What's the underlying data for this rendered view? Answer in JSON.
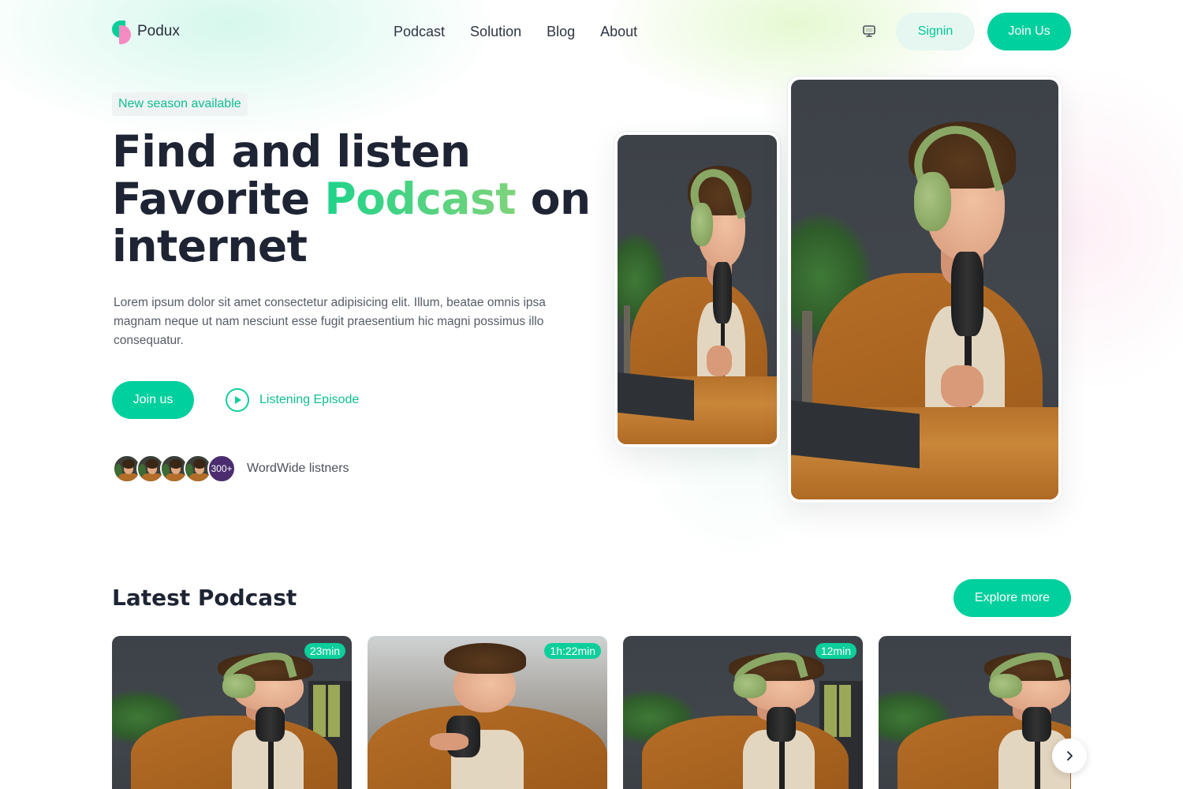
{
  "brand": {
    "name": "Podux"
  },
  "nav": {
    "links": [
      "Podcast",
      "Solution",
      "Blog",
      "About"
    ],
    "theme_icon": "monitor-icon",
    "signin_label": "Signin",
    "join_label": "Join Us"
  },
  "hero": {
    "badge": "New season available",
    "title_line1": "Find and listen",
    "title_line2_pre": "Favorite ",
    "title_accent": "Podcast",
    "title_line2_post": " on",
    "title_line3": "internet",
    "description": "Lorem ipsum dolor sit amet consectetur adipisicing elit. Illum, beatae omnis ipsa magnam neque ut nam nesciunt esse fugit praesentium hic magni possimus illo consequatur.",
    "cta_label": "Join us",
    "listen_label": "Listening Episode",
    "listeners_count": "300+",
    "listeners_label": "WordWide listners"
  },
  "latest": {
    "title": "Latest Podcast",
    "explore_label": "Explore more",
    "cards": [
      {
        "duration": "23min"
      },
      {
        "duration": "1h:22min"
      },
      {
        "duration": "12min"
      },
      {
        "duration": ""
      }
    ]
  },
  "colors": {
    "primary": "#00d09e",
    "primary_soft": "#e6f7f1",
    "heading": "#1e2433",
    "accent_gradient_start": "#1fd38a",
    "accent_gradient_end": "#7ed37a",
    "avatar_count_bg": "#4b2d6f"
  }
}
